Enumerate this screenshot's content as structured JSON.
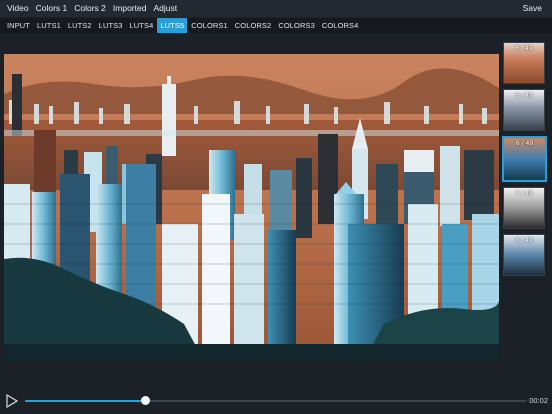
{
  "menu": {
    "items": [
      "Video",
      "Colors 1",
      "Colors 2",
      "Imported",
      "Adjust"
    ],
    "save_label": "Save"
  },
  "tabs": {
    "items": [
      "INPUT",
      "LUTS1",
      "LUTS2",
      "LUTS3",
      "LUTS4",
      "LUTS5",
      "COLORS1",
      "COLORS2",
      "COLORS3",
      "COLORS4"
    ],
    "active_index": 5
  },
  "thumbnails": {
    "items": [
      {
        "label": "6 / 49",
        "tint": "#c97b5a"
      },
      {
        "label": "6 / 49",
        "tint": "#8a96a6"
      },
      {
        "label": "6 / 49",
        "tint": "#3f7fb0"
      },
      {
        "label": "7 / 49",
        "tint": "#9a9a9a"
      },
      {
        "label": "8 / 49",
        "tint": "#5a86a8"
      }
    ],
    "active_index": 2
  },
  "player": {
    "time": "00:02",
    "progress": 0.24
  },
  "colors": {
    "accent": "#2a9fd6"
  }
}
